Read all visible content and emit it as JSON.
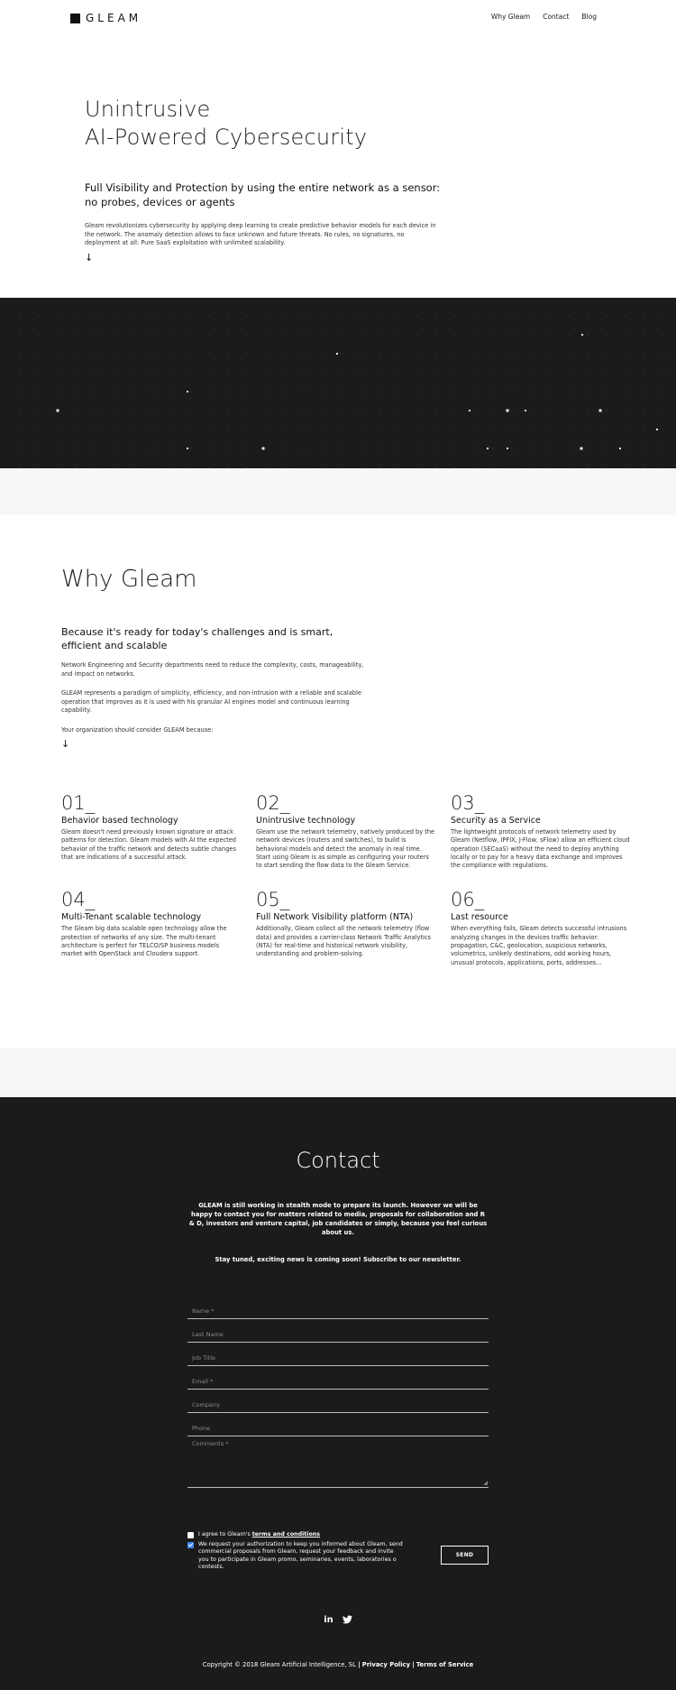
{
  "header": {
    "logo_text": "GLEAM",
    "nav": [
      "Why Gleam",
      "Contact",
      "Blog"
    ]
  },
  "hero": {
    "title_line1": "Unintrusive",
    "title_line2": "AI-Powered Cybersecurity",
    "subtitle": "Full Visibility and Protection by using the entire network as a sensor: no probes, devices or agents",
    "body": "Gleam revolutionizes cybersecurity by applying deep learning to create predictive behavior models for each device in the network. The anomaly detection allows to face unknown and future threats. No rules, no signatures, no deployment at all: Pure SaaS exploitation with unlimited scalability.",
    "arrow": "↓"
  },
  "why": {
    "title": "Why Gleam",
    "subtitle": "Because it's ready for today's challenges and is smart, efficient and scalable",
    "p1": "Network Engineering and Security departments need to reduce the complexity, costs, manageability, and impact on networks.",
    "p2": "GLEAM represents a paradigm of simplicity, efficiency, and non-intrusion with a reliable and scalable operation that improves as it is used with his granular AI engines model and continuous learning capability.",
    "p3": "Your organization should consider GLEAM because:",
    "arrow": "↓",
    "features": [
      {
        "num": "01_",
        "title": "Behavior based technology",
        "text": "Gleam doesn't need previously known signature or attack patterns for detection. Gleam models with AI the expected behavior of the traffic network and detects subtle changes that are indications of a successful attack."
      },
      {
        "num": "02_",
        "title": "Unintrusive technology",
        "text": "Gleam use the network telemetry, natively produced by the network devices (routers and switches), to build is behavioral models and detect the anomaly in real time. Start using Gleam is as simple as configuring your routers to start sending the flow data to the Gleam Service."
      },
      {
        "num": "03_",
        "title": "Security as a Service",
        "text": "The lightweight protocols of network telemetry used by Gleam (Netflow, IPFIX, J-Flow, sFlow) allow an efficient cloud operation (SECaaS) without the need to deploy anything locally or to pay for a heavy data exchange and improves the compliance with regulations."
      },
      {
        "num": "04_",
        "title": "Multi-Tenant scalable technology",
        "text": "The Gleam big data scalable open technology allow the protection of networks of any size. The multi-tenant architecture is perfect for TELCO/SP business models market with OpenStack and Cloudera support."
      },
      {
        "num": "05_",
        "title": "Full Network Visibility platform (NTA)",
        "text": "Additionally, Gleam collect all the network telemetry (flow data) and provides a carrier-class Network Traffic Analytics (NTA) for real-time and historical network visibility, understanding and problem-solving."
      },
      {
        "num": "06_",
        "title": "Last resource",
        "text": "When everything fails, Gleam detects successful intrusions analyzing changes in the devices traffic behavior: propagation, C&C, geolocation, suspicious networks, volumetrics, unlikely destinations, odd working hours, unusual protocols, applications, ports, addresses..."
      }
    ]
  },
  "contact": {
    "title": "Contact",
    "intro": "GLEAM is still working in stealth mode to prepare its launch. However we will be happy to contact you for matters related to media, proposals for collaboration and R & D, investors and venture capital, job candidates or simply, because you feel curious about us.",
    "newsletter": "Stay tuned, exciting news is coming soon! Subscribe to our newsletter.",
    "fields": {
      "name": "Name *",
      "last_name": "Last Name",
      "job_title": "Job Title",
      "email": "Email *",
      "company": "Company",
      "phone": "Phone",
      "comments": "Comments *"
    },
    "agree_prefix": "I agree to Gleam's",
    "agree_link": "terms and conditions",
    "consent": "We request your authorization to keep you informed about Gleam, send commercial proposals from Gleam, request your feedback and invite you to participate in Gleam promo, seminaries, events, laboratories o contests.",
    "send": "SEND"
  },
  "footer": {
    "linkedin": "in",
    "twitter": "twitter-icon",
    "copyright": "Copyright © 2018 Gleam Artificial Intelligence, SL",
    "sep": "|",
    "privacy": "Privacy Policy",
    "terms": "Terms of Service"
  }
}
